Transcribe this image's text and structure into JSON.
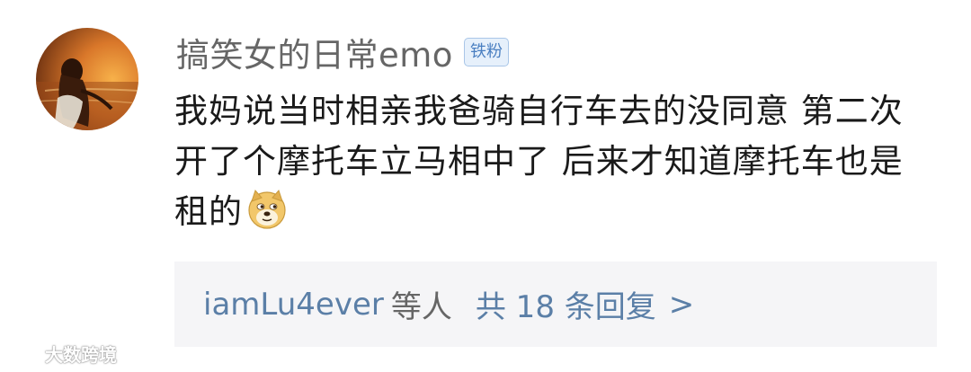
{
  "comment": {
    "username": "搞笑女的日常emo",
    "badge": "铁粉",
    "text": "我妈说当时相亲我爸骑自行车去的没同意 第二次开了个摩托车立马相中了 后来才知道摩托车也是租的",
    "emoji": "doge-emoji",
    "avatar": "avatar-sunset-girl"
  },
  "replies": {
    "user": "iamLu4ever",
    "etc": "等人",
    "count_text": "共 18 条回复",
    "chevron": ">"
  },
  "watermark": {
    "text": "大数跨境",
    "icon": "bilibili-logo-icon"
  }
}
